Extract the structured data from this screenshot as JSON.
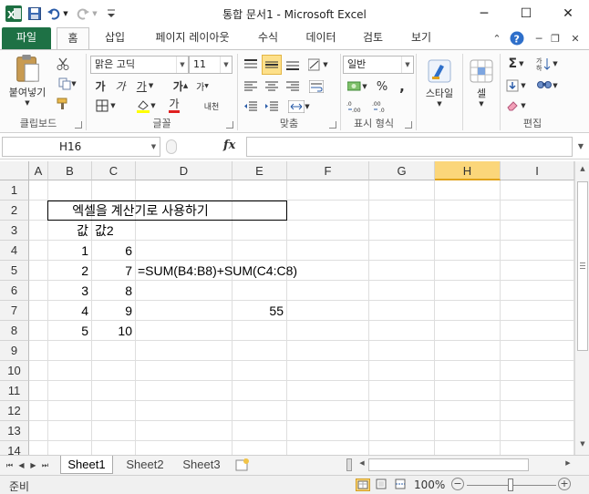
{
  "window": {
    "title": "통합 문서1  -  Microsoft Excel",
    "minimize": "─",
    "maximize": "☐",
    "close": "✕"
  },
  "tabs": [
    {
      "label": "파일"
    },
    {
      "label": "홈"
    },
    {
      "label": "삽입"
    },
    {
      "label": "페이지 레이아웃"
    },
    {
      "label": "수식"
    },
    {
      "label": "데이터"
    },
    {
      "label": "검토"
    },
    {
      "label": "보기"
    }
  ],
  "ribbon": {
    "clipboard": {
      "label": "클립보드",
      "paste": "붙여넣기"
    },
    "font": {
      "label": "글꼴",
      "name": "맑은 고딕",
      "size": "11",
      "bold": "가",
      "italic": "가",
      "underline": "가",
      "grow": "가",
      "shrink": "가",
      "color_letter": "가",
      "phonetic": "내천"
    },
    "alignment": {
      "label": "맞춤"
    },
    "number": {
      "label": "표시 형식",
      "format": "일반"
    },
    "styles": {
      "label": "스타일",
      "button": "스타일"
    },
    "cells": {
      "label": "셀",
      "button": "셀"
    },
    "editing": {
      "label": "편집"
    }
  },
  "formula_bar": {
    "name_box": "H16",
    "fx": "fx",
    "formula": ""
  },
  "columns": [
    "A",
    "B",
    "C",
    "D",
    "E",
    "F",
    "G",
    "H",
    "I"
  ],
  "selected_column": "H",
  "rows": [
    "1",
    "2",
    "3",
    "4",
    "5",
    "6",
    "7",
    "8",
    "9",
    "10",
    "11",
    "12",
    "13",
    "14"
  ],
  "cells": {
    "B2": "엑셀을 계산기로 사용하기",
    "B3": "값",
    "C3": "값2",
    "B4": "1",
    "C4": "6",
    "B5": "2",
    "C5": "7",
    "D5": "=SUM(B4:B8)+SUM(C4:C8)",
    "B6": "3",
    "C6": "8",
    "B7": "4",
    "C7": "9",
    "E7": "55",
    "B8": "5",
    "C8": "10"
  },
  "sheets": [
    "Sheet1",
    "Sheet2",
    "Sheet3"
  ],
  "active_sheet": "Sheet1",
  "status": {
    "ready": "준비",
    "zoom": "100%",
    "zoom_out": "−",
    "zoom_in": "+"
  }
}
